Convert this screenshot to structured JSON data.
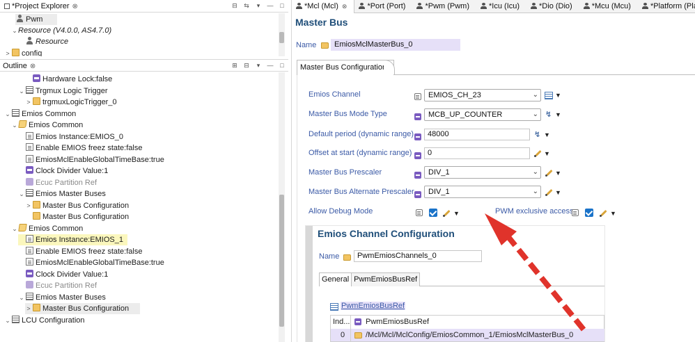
{
  "project_explorer": {
    "tab_label": "*Project Explorer",
    "close_glyph": "⊗",
    "items": [
      {
        "label": "Pwm",
        "icon": "component-icon",
        "twisty": ""
      },
      {
        "label": "Resource (V4.0.0, AS4.7.0)",
        "icon": "",
        "twisty": "⌄"
      },
      {
        "label": "Resource",
        "icon": "component-icon",
        "twisty": ""
      },
      {
        "label": "config",
        "icon": "folder-icon",
        "twisty": ">"
      }
    ]
  },
  "outline": {
    "tab_label": "Outline",
    "close_glyph": "⊗",
    "items": [
      {
        "label": "Hardware Lock:false",
        "icon": "bool"
      },
      {
        "label": "Trgmux Logic Trigger",
        "icon": "list",
        "twisty": "⌄"
      },
      {
        "label": "trgmuxLogicTrigger_0",
        "icon": "folder",
        "twisty": ">"
      },
      {
        "label": "Emios Common",
        "icon": "list",
        "twisty": "⌄"
      },
      {
        "label": "Emios Common",
        "icon": "folder-open",
        "twisty": "⌄"
      },
      {
        "label": "Emios Instance:EMIOS_0",
        "icon": "doc"
      },
      {
        "label": "Enable EMIOS freez state:false",
        "icon": "doc"
      },
      {
        "label": "EmiosMclEnableGlobalTimeBase:true",
        "icon": "doc"
      },
      {
        "label": "Clock Divider Value:1",
        "icon": "bool"
      },
      {
        "label": "Ecuc Partition Ref",
        "icon": "bool-gray",
        "gray": true
      },
      {
        "label": "Emios Master Buses",
        "icon": "list",
        "twisty": "⌄"
      },
      {
        "label": "Master Bus Configuration",
        "icon": "folder",
        "twisty": ">"
      },
      {
        "label": "Master Bus Configuration",
        "icon": "folder"
      },
      {
        "label": "Emios Common",
        "icon": "folder-open",
        "twisty": "⌄"
      },
      {
        "label": "Emios Instance:EMIOS_1",
        "icon": "doc",
        "hilite": true
      },
      {
        "label": "Enable EMIOS freez state:false",
        "icon": "doc"
      },
      {
        "label": "EmiosMclEnableGlobalTimeBase:true",
        "icon": "doc"
      },
      {
        "label": "Clock Divider Value:1",
        "icon": "bool"
      },
      {
        "label": "Ecuc Partition Ref",
        "icon": "bool-gray",
        "gray": true
      },
      {
        "label": "Emios Master Buses",
        "icon": "list",
        "twisty": "⌄"
      },
      {
        "label": "Master Bus Configuration",
        "icon": "folder",
        "twisty": ">",
        "selected": true
      },
      {
        "label": "LCU Configuration",
        "icon": "list",
        "twisty": "⌄"
      }
    ]
  },
  "editor_tabs": [
    {
      "label": "*Mcl (Mcl)",
      "active": true,
      "close": "⊗"
    },
    {
      "label": "*Port (Port)"
    },
    {
      "label": "*Pwm (Pwm)"
    },
    {
      "label": "*Icu (Icu)"
    },
    {
      "label": "*Dio (Dio)"
    },
    {
      "label": "*Mcu (Mcu)"
    },
    {
      "label": "*Platform (Platform"
    }
  ],
  "editor": {
    "title": "Master Bus",
    "name_label": "Name",
    "name_value": "EmiosMclMasterBus_0",
    "section_tab": "Master Bus Configuration",
    "fields": {
      "emios_channel": {
        "label": "Emios Channel",
        "value": "EMIOS_CH_23"
      },
      "mode_type": {
        "label": "Master Bus Mode Type",
        "value": "MCB_UP_COUNTER"
      },
      "default_period": {
        "label": "Default period (dynamic range)",
        "value": "48000"
      },
      "offset": {
        "label": "Offset at start (dynamic range)",
        "value": "0"
      },
      "prescaler": {
        "label": "Master Bus Prescaler",
        "value": "DIV_1"
      },
      "alt_prescaler": {
        "label": "Master Bus Alternate Prescaler",
        "value": "DIV_1"
      },
      "debug_mode": {
        "label": "Allow Debug Mode",
        "checked": true
      },
      "pwm_exclusive": {
        "label": "PWM exclusive access",
        "checked": true
      }
    }
  },
  "inner": {
    "title": "Emios Channel Configuration",
    "name_label": "Name",
    "name_value": "PwmEmiosChannels_0",
    "tabs": [
      "General",
      "PwmEmiosBusRef"
    ],
    "section_label": "PwmEmiosBusRef",
    "grid_headers": [
      "Ind...",
      "PwmEmiosBusRef"
    ],
    "grid_rows": [
      {
        "index": "0",
        "value": "/Mcl/Mcl/MclConfig/EmiosCommon_1/EmiosMclMasterBus_0"
      }
    ]
  },
  "colors": {
    "label_blue": "#3b5aa6",
    "title_blue": "#1f4e79",
    "arrow_red": "#e0332b",
    "highlight_yellow": "#fbf7bd",
    "lavender": "#e6e0f8",
    "checkbox_blue": "#1a73c9"
  }
}
